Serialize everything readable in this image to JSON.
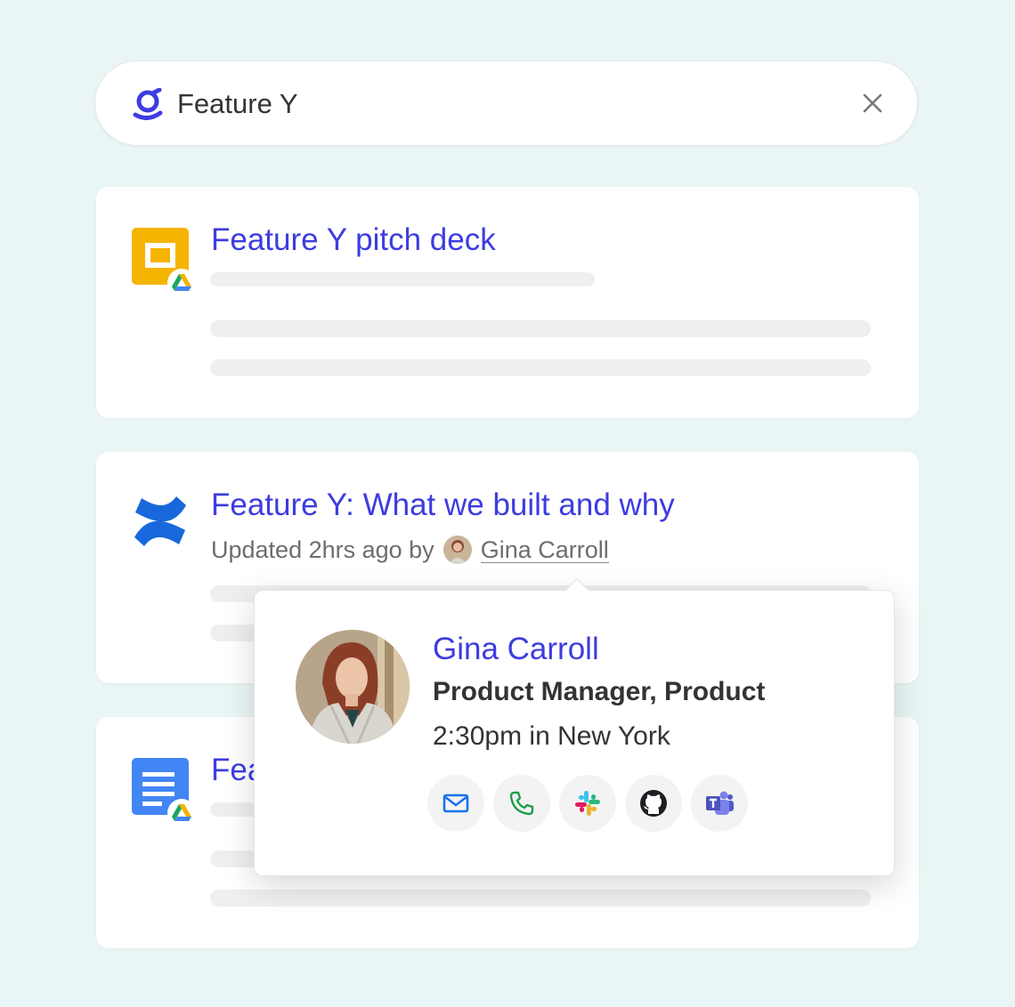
{
  "search": {
    "query": "Feature Y",
    "logo_icon": "glean-logo-icon",
    "clear_icon": "close-icon"
  },
  "results": [
    {
      "title": "Feature Y pitch deck",
      "icon": "google-slides-icon",
      "source_icon": "google-drive-icon"
    },
    {
      "title": "Feature Y: What we built and why",
      "icon": "confluence-icon",
      "meta_prefix": "Updated 2hrs ago by",
      "author": "Gina Carroll"
    },
    {
      "title": "Fea",
      "icon": "google-docs-icon",
      "source_icon": "google-drive-icon"
    }
  ],
  "profile_card": {
    "name": "Gina Carroll",
    "role": "Product Manager, Product",
    "local_time": "2:30pm in New York",
    "actions": [
      "email-icon",
      "phone-icon",
      "slack-icon",
      "github-icon",
      "teams-icon"
    ]
  },
  "colors": {
    "background": "#EAF6F5",
    "link": "#3D3CE0",
    "skeleton": "#EFEFEF"
  }
}
